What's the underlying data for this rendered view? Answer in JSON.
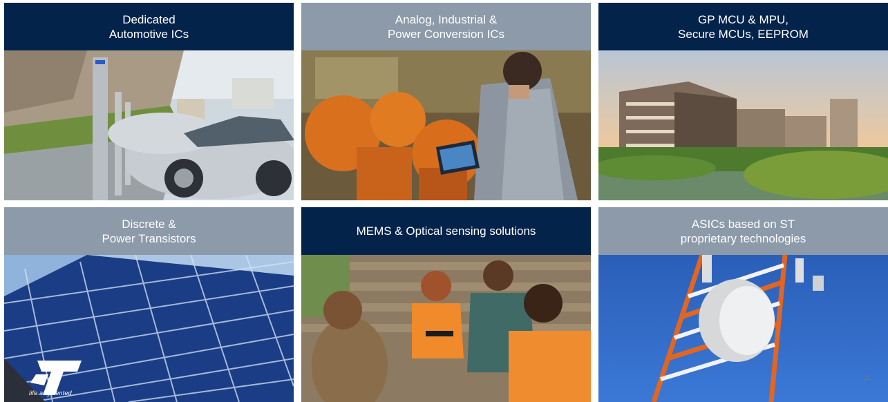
{
  "tiles": [
    {
      "label": "Dedicated\nAutomotive ICs",
      "style": "navy",
      "image": "electric-car-charging-photo"
    },
    {
      "label": "Analog, Industrial &\nPower Conversion ICs",
      "style": "gray",
      "image": "industrial-robot-tablet-photo"
    },
    {
      "label": "GP MCU & MPU,\nSecure MCUs, EEPROM",
      "style": "navy",
      "image": "smart-building-photo"
    },
    {
      "label": "Discrete &\nPower Transistors",
      "style": "gray",
      "image": "solar-panel-photo"
    },
    {
      "label": "MEMS & Optical sensing solutions",
      "style": "navy",
      "image": "fitness-friends-photo"
    },
    {
      "label": "ASICs based on ST\nproprietary technologies",
      "style": "gray",
      "image": "telecom-tower-photo"
    }
  ],
  "brand": {
    "tagline": "life.augmented",
    "logo": "st-logo"
  },
  "page_number": "21",
  "colors": {
    "navy": "#03234b",
    "gray": "#8c9aaa"
  }
}
